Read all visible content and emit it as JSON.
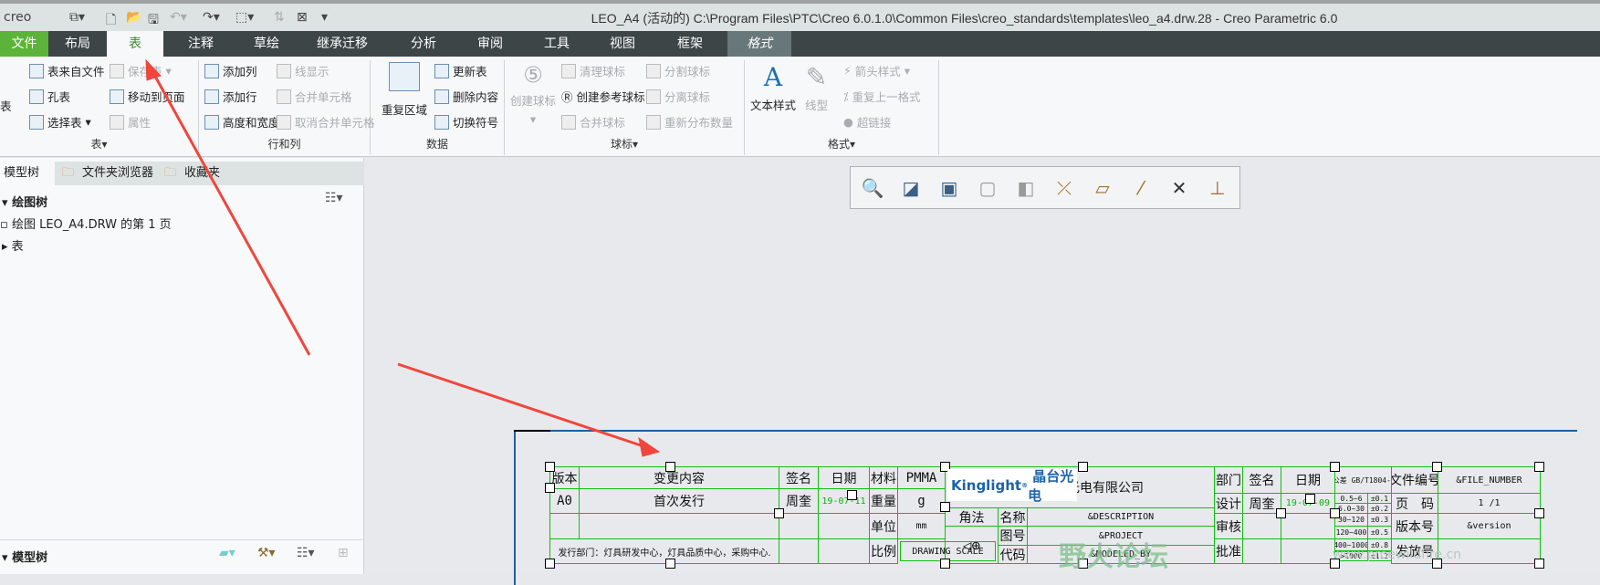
{
  "window": {
    "title": "LEO_A4 (活动的) C:\\Program Files\\PTC\\Creo 6.0.1.0\\Common Files\\creo_standards\\templates\\leo_a4.drw.28 - Creo Parametric 6.0",
    "brand": "creo"
  },
  "tabs": [
    "文件",
    "布局",
    "表",
    "注释",
    "草绘",
    "继承迁移",
    "分析",
    "审阅",
    "工具",
    "视图",
    "框架",
    "格式"
  ],
  "ribbon": {
    "table_group": {
      "label": "表",
      "big": "表",
      "items": [
        "表来自文件",
        "保存表",
        "孔表",
        "移动到页面",
        "选择表",
        "属性"
      ]
    },
    "rowcol_group": {
      "label": "行和列",
      "items": [
        "添加列",
        "线显示",
        "添加行",
        "合并单元格",
        "高度和宽度",
        "取消合并单元格"
      ]
    },
    "data_group": {
      "label": "数据",
      "big": "重复区域",
      "items": [
        "更新表",
        "删除内容",
        "切换符号"
      ]
    },
    "balloon_group": {
      "label": "球标",
      "big": "创建球标",
      "items": [
        "清理球标",
        "分割球标",
        "创建参考球标",
        "分离球标",
        "合并球标",
        "重新分布数量"
      ]
    },
    "format_group": {
      "label": "格式",
      "big1": "文本样式",
      "big2": "线型",
      "items": [
        "箭头样式",
        "重复上一格式",
        "超链接"
      ]
    }
  },
  "leftpanel": {
    "tabs": [
      "模型树",
      "文件夹浏览器",
      "收藏夹"
    ],
    "tree_header": "绘图树",
    "items": [
      "绘图 LEO_A4.DRW 的第 1 页",
      "表"
    ],
    "bottom_header": "模型树"
  },
  "titleblock": {
    "h_version": "版本",
    "h_change": "变更内容",
    "h_sign": "签名",
    "h_date": "日期",
    "h_material": "材料",
    "material": "PMMA",
    "version": "A0",
    "change": "首次发行",
    "signer": "周奎",
    "date1": "19-07-11",
    "h_weight": "重量",
    "weight": "g",
    "h_unit": "单位",
    "unit": "mm",
    "issue_dept": "发行部门：灯具研发中心，灯具品质中心，采购中心.",
    "h_scale": "比例",
    "scale": "DRAWING SCALE",
    "logo": "Kinglight® 晶台光电",
    "company": "苏州晶台光电有限公司",
    "h_angle": "角法",
    "h_name": "名称",
    "name": "&DESCRIPTION",
    "h_drawno": "图号",
    "drawno": "&PROJECT",
    "h_code": "代码",
    "code": "&MODELED_BY",
    "h_dept": "部门",
    "h_sign2": "签名",
    "h_date2": "日期",
    "tol_title": "未标公差 GB/T1804-2000",
    "h_design": "设计",
    "designer": "周奎",
    "date2": "19-07-09",
    "h_review": "审核",
    "h_approve": "批准",
    "tol": [
      [
        "0.5~6",
        "±0.1"
      ],
      [
        "6.0~30",
        "±0.2"
      ],
      [
        "30~120",
        "±0.3"
      ],
      [
        "120~400",
        "±0.5"
      ],
      [
        "400~1000",
        "±0.8"
      ],
      [
        ">1000",
        "±1.2"
      ]
    ],
    "h_fileno": "文件编号",
    "fileno": "&FILE_NUMBER",
    "h_page": "页　码",
    "page": "1 /1",
    "h_rev": "版本号",
    "rev": "&version",
    "h_release": "发放号"
  },
  "watermark": {
    "title": "野火论坛",
    "url": "www.proewildfire.cn"
  },
  "colors": {
    "grid": "#10c010",
    "annotation_arrow": "#f0463c"
  }
}
